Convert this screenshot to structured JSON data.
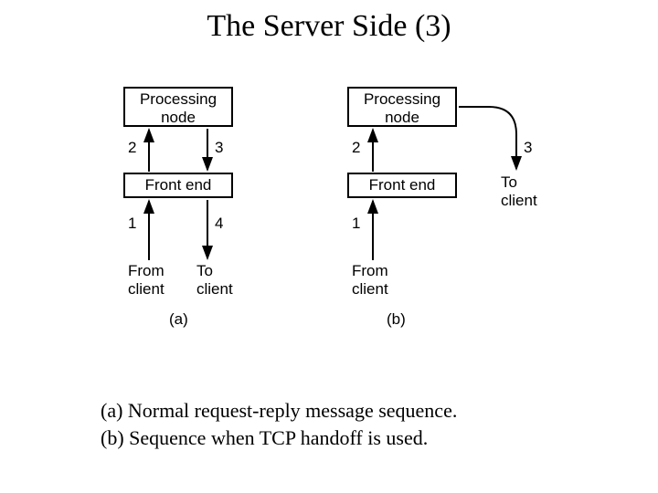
{
  "title": "The Server Side (3)",
  "diagram": {
    "a": {
      "processing_node": "Processing\nnode",
      "front_end": "Front end",
      "arrows": {
        "n1": "1",
        "n2": "2",
        "n3": "3",
        "n4": "4"
      },
      "from_client": "From\nclient",
      "to_client": "To\nclient",
      "letter": "(a)"
    },
    "b": {
      "processing_node": "Processing\nnode",
      "front_end": "Front end",
      "arrows": {
        "n1": "1",
        "n2": "2",
        "n3": "3"
      },
      "from_client": "From\nclient",
      "to_client": "To\nclient",
      "letter": "(b)"
    }
  },
  "caption": {
    "line1": "(a) Normal request-reply message sequence.",
    "line2": "(b) Sequence when TCP handoff is used."
  }
}
